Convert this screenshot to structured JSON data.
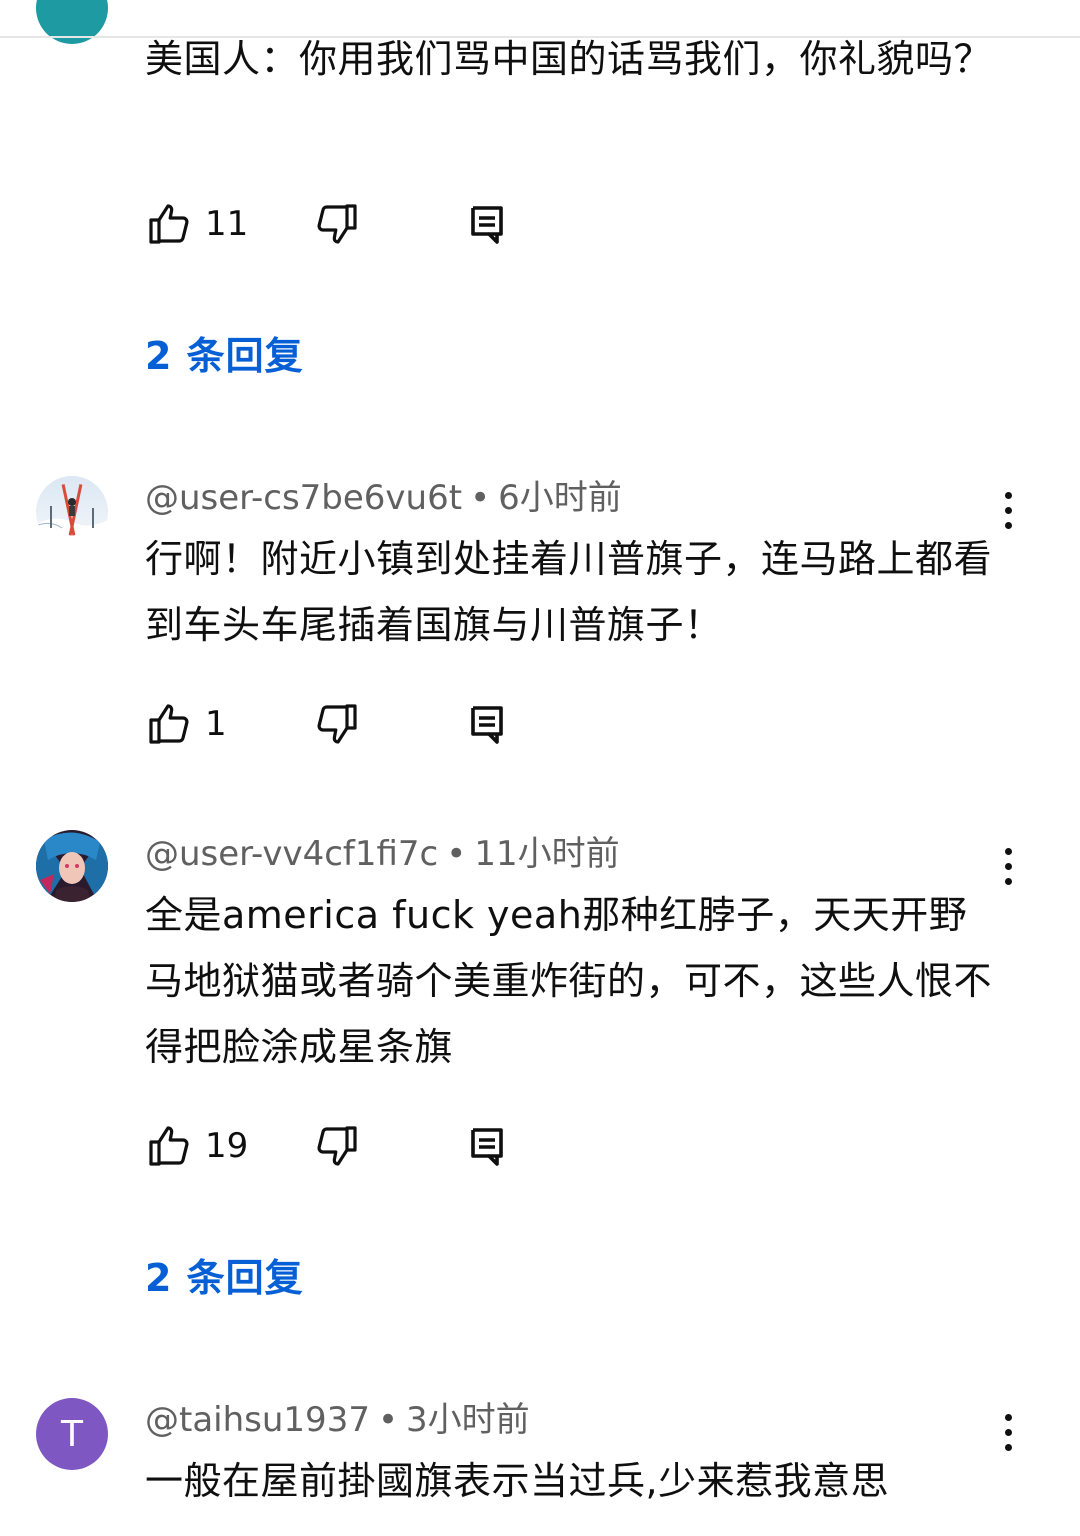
{
  "comments": [
    {
      "author": "",
      "time": "",
      "text": "美国人：你用我们骂中国的话骂我们，你礼貌吗？",
      "likes": "11",
      "replies_label": "2 条回复"
    },
    {
      "author": "@user-cs7be6vu6t",
      "separator": "•",
      "time": "6小时前",
      "text": "行啊！附近小镇到处挂着川普旗子，连马路上都看到车头车尾插着国旗与川普旗子！",
      "likes": "1"
    },
    {
      "author": "@user-vv4cf1fi7c",
      "separator": "•",
      "time": "11小时前",
      "text": "全是america fuck yeah那种红脖子，天天开野马地狱猫或者骑个美重炸街的，可不，这些人恨不得把脸涂成星条旗",
      "likes": "19",
      "replies_label": "2 条回复"
    },
    {
      "author": "@taihsu1937",
      "separator": "•",
      "time": "3小时前",
      "text": "一般在屋前掛國旗表示当过兵,少来惹我意思",
      "avatar_letter": "T",
      "avatar_color": "#7e57c2"
    }
  ],
  "colors": {
    "link": "#065fd4",
    "meta": "#606060",
    "text": "#0f0f0f"
  },
  "icons": [
    "thumb-up-icon",
    "thumb-down-icon",
    "comment-reply-icon",
    "more-vert-icon"
  ]
}
